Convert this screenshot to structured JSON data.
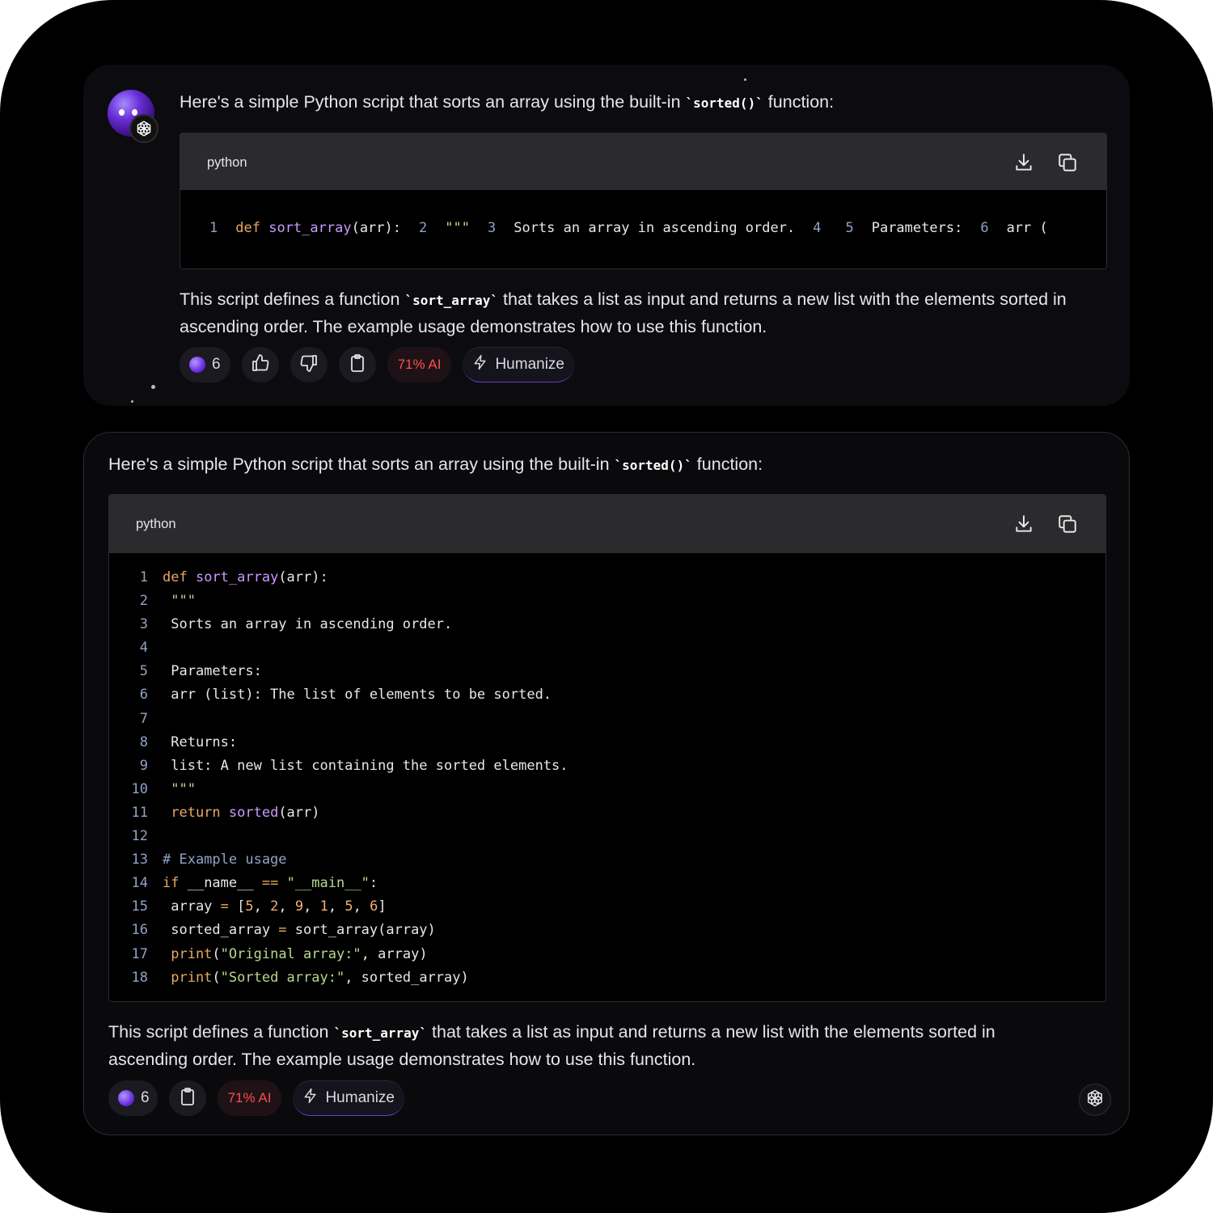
{
  "collapsed_message": {
    "intro_pre": "Here's a simple Python script that sorts an array using the built-in ",
    "intro_code": "`sorted()`",
    "intro_post": " function:",
    "code_language": "python",
    "code_preview_numbers": [
      "1",
      "2",
      "3",
      "4",
      "5",
      "6"
    ],
    "code_preview_text": [
      "def",
      "sort_array",
      "(arr):",
      "\"\"\"",
      "Sorts an array in ascending order.",
      "",
      "Parameters:",
      "arr ("
    ],
    "summary_pre": "This script defines a function ",
    "summary_code": "`sort_array`",
    "summary_post": " that takes a list as input and returns a new list with the elements sorted in ascending order. The example usage demonstrates how to use this function.",
    "actions": {
      "count": "6",
      "ai_score": "71% AI",
      "humanize": "Humanize"
    }
  },
  "expanded_message": {
    "intro_pre": "Here's a simple Python script that sorts an array using the built-in ",
    "intro_code": "`sorted()`",
    "intro_post": " function:",
    "code_language": "python",
    "code_lines": [
      {
        "n": "1",
        "parts": [
          [
            "kw",
            "def "
          ],
          [
            "fn",
            "sort_array"
          ],
          [
            "",
            "(arr):"
          ]
        ]
      },
      {
        "n": "2",
        "parts": [
          [
            "str",
            " \"\"\""
          ]
        ]
      },
      {
        "n": "3",
        "parts": [
          [
            "",
            " Sorts an array in ascending order."
          ]
        ]
      },
      {
        "n": "4",
        "parts": [
          [
            "",
            ""
          ]
        ]
      },
      {
        "n": "5",
        "parts": [
          [
            "",
            " Parameters:"
          ]
        ]
      },
      {
        "n": "6",
        "parts": [
          [
            "",
            " arr (list): The list of elements to be sorted."
          ]
        ]
      },
      {
        "n": "7",
        "parts": [
          [
            "",
            ""
          ]
        ]
      },
      {
        "n": "8",
        "parts": [
          [
            "",
            " Returns:"
          ]
        ]
      },
      {
        "n": "9",
        "parts": [
          [
            "",
            " list: A new list containing the sorted elements."
          ]
        ]
      },
      {
        "n": "10",
        "parts": [
          [
            "str",
            " \"\"\""
          ]
        ]
      },
      {
        "n": "11",
        "parts": [
          [
            "kw",
            " return "
          ],
          [
            "fn",
            "sorted"
          ],
          [
            "",
            "(arr)"
          ]
        ]
      },
      {
        "n": "12",
        "parts": [
          [
            "",
            ""
          ]
        ]
      },
      {
        "n": "13",
        "parts": [
          [
            "cm",
            "# Example usage"
          ]
        ]
      },
      {
        "n": "14",
        "parts": [
          [
            "kw",
            "if "
          ],
          [
            "",
            "__name__ "
          ],
          [
            "kw",
            "=="
          ],
          [
            "str",
            " \"__main__\""
          ],
          [
            "",
            ":"
          ]
        ]
      },
      {
        "n": "15",
        "parts": [
          [
            "",
            " array "
          ],
          [
            "kw",
            "="
          ],
          [
            "",
            " ["
          ],
          [
            "nm",
            "5"
          ],
          [
            "",
            ", "
          ],
          [
            "nm",
            "2"
          ],
          [
            "",
            ", "
          ],
          [
            "nm",
            "9"
          ],
          [
            "",
            ", "
          ],
          [
            "nm",
            "1"
          ],
          [
            "",
            ", "
          ],
          [
            "nm",
            "5"
          ],
          [
            "",
            ", "
          ],
          [
            "nm",
            "6"
          ],
          [
            "",
            "]"
          ]
        ]
      },
      {
        "n": "16",
        "parts": [
          [
            "",
            " sorted_array "
          ],
          [
            "kw",
            "="
          ],
          [
            "",
            " sort_array(array)"
          ]
        ]
      },
      {
        "n": "17",
        "parts": [
          [
            "kw",
            " print"
          ],
          [
            "",
            "("
          ],
          [
            "str",
            "\"Original array:\""
          ],
          [
            "",
            ", array)"
          ]
        ]
      },
      {
        "n": "18",
        "parts": [
          [
            "kw",
            " print"
          ],
          [
            "",
            "("
          ],
          [
            "str",
            "\"Sorted array:\""
          ],
          [
            "",
            ", sorted_array)"
          ]
        ]
      }
    ],
    "summary_pre": "This script defines a function ",
    "summary_code": "`sort_array`",
    "summary_post": " that takes a list as input and returns a new list with the elements sorted in ascending order. The example usage demonstrates how to use this function.",
    "actions": {
      "count": "6",
      "ai_score": "71% AI",
      "humanize": "Humanize"
    }
  },
  "icons": {
    "download": "download-icon",
    "copy": "copy-icon",
    "thumbs_up": "thumbs-up-icon",
    "thumbs_down": "thumbs-down-icon",
    "clipboard": "clipboard-icon",
    "bolt": "bolt-icon",
    "openai": "openai-logo-icon"
  },
  "colors": {
    "ai_score": "#ff4d4d",
    "accent": "#6d3ad6",
    "background": "#000000"
  }
}
